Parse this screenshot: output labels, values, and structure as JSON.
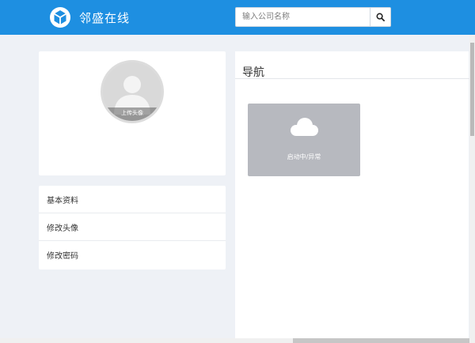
{
  "header": {
    "brand_name": "邻盛在线",
    "logo_icon": "unity-cube-icon",
    "accent_color": "#1e8fe1"
  },
  "search": {
    "placeholder": "输入公司名称",
    "button_icon": "search-icon"
  },
  "profile": {
    "avatar_icon": "user-silhouette-icon",
    "avatar_caption": "上传头像"
  },
  "sidebar": {
    "items": [
      {
        "label": "基本资料"
      },
      {
        "label": "修改头像"
      },
      {
        "label": "修改密码"
      }
    ]
  },
  "nav": {
    "title": "导航",
    "tiles": [
      {
        "icon": "cloud-icon",
        "label": "启动中/异常"
      }
    ]
  }
}
